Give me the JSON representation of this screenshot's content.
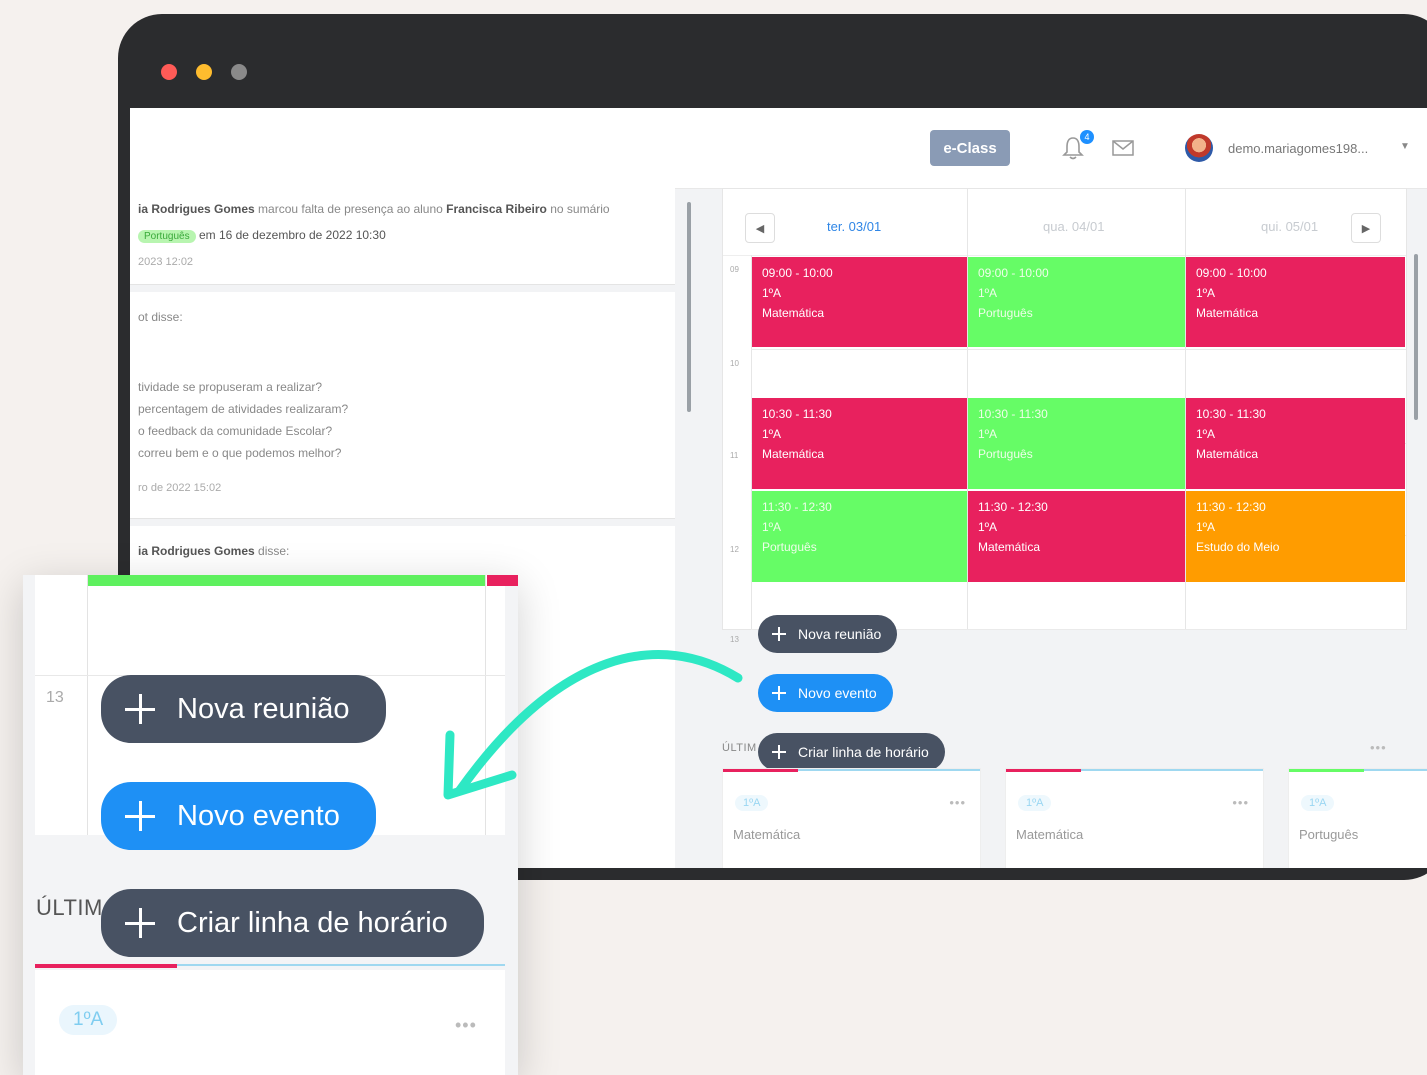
{
  "window": {
    "controls": [
      "close",
      "minimize",
      "maximize"
    ]
  },
  "topbar": {
    "eclass_label": "e-Class",
    "notification_count": "4",
    "username": "demo.mariagomes198...",
    "icons": [
      "bell-icon",
      "mail-icon",
      "chevron-down-icon"
    ]
  },
  "feed": [
    {
      "actor": "ia Rodrigues Gomes",
      "text_before": " marcou falta de presença ao aluno ",
      "student": "Francisca Ribeiro",
      "text_after": " no sumário",
      "chip": "Português",
      "date_text": "em 16 de dezembro de 2022 10:30",
      "timestamp": "2023 12:02"
    },
    {
      "actor_line": "ot disse:",
      "questions": [
        "tividade se propuseram a realizar?",
        "percentagem de atividades realizaram?",
        "o feedback da comunidade Escolar?",
        "correu bem e o que podemos melhor?"
      ],
      "timestamp": "ro de 2022 15:02"
    },
    {
      "actor": "ia Rodrigues Gomes",
      "suffix": " disse:"
    }
  ],
  "calendar": {
    "days": [
      "ter. 03/01",
      "qua. 04/01",
      "qui. 05/01"
    ],
    "hours": [
      "09",
      "10",
      "11",
      "12",
      "13"
    ],
    "slots": [
      {
        "time": "09:00 - 10:00",
        "class": "1ºA",
        "subject": "Matemática",
        "color": "#e8215e"
      },
      {
        "time": "09:00 - 10:00",
        "class": "1ºA",
        "subject": "Português",
        "color": "#66fc66"
      },
      {
        "time": "09:00 - 10:00",
        "class": "1ºA",
        "subject": "Matemática",
        "color": "#e8215e"
      },
      {
        "time": "10:30 - 11:30",
        "class": "1ºA",
        "subject": "Matemática",
        "color": "#e8215e"
      },
      {
        "time": "10:30 - 11:30",
        "class": "1ºA",
        "subject": "Português",
        "color": "#66fc66"
      },
      {
        "time": "10:30 - 11:30",
        "class": "1ºA",
        "subject": "Matemática",
        "color": "#e8215e"
      },
      {
        "time": "11:30 - 12:30",
        "class": "1ºA",
        "subject": "Português",
        "color": "#66fc66"
      },
      {
        "time": "11:30 - 12:30",
        "class": "1ºA",
        "subject": "Matemática",
        "color": "#e8215e"
      },
      {
        "time": "11:30 - 12:30",
        "class": "1ºA",
        "subject": "Estudo do Meio",
        "color": "#ff9c00"
      }
    ]
  },
  "actions": {
    "nova_reuniao": "Nova reunião",
    "novo_evento": "Novo evento",
    "criar_linha": "Criar linha de horário"
  },
  "ultimas": {
    "label_small": "ÚLTIM",
    "label_zoom": "ÚLTIM",
    "cards": [
      {
        "class": "1ºA",
        "subject": "Matemática"
      },
      {
        "class": "1ºA",
        "subject": "Matemática"
      },
      {
        "class": "1ºA",
        "subject": "Português"
      }
    ]
  },
  "zoom": {
    "hour": "13",
    "class": "1ºA"
  },
  "colors": {
    "accent_blue": "#1e90f5",
    "dark_pill": "#485263",
    "red": "#e8215e",
    "green": "#66fc66",
    "orange": "#ff9c00",
    "arrow": "#2ee8c4"
  }
}
